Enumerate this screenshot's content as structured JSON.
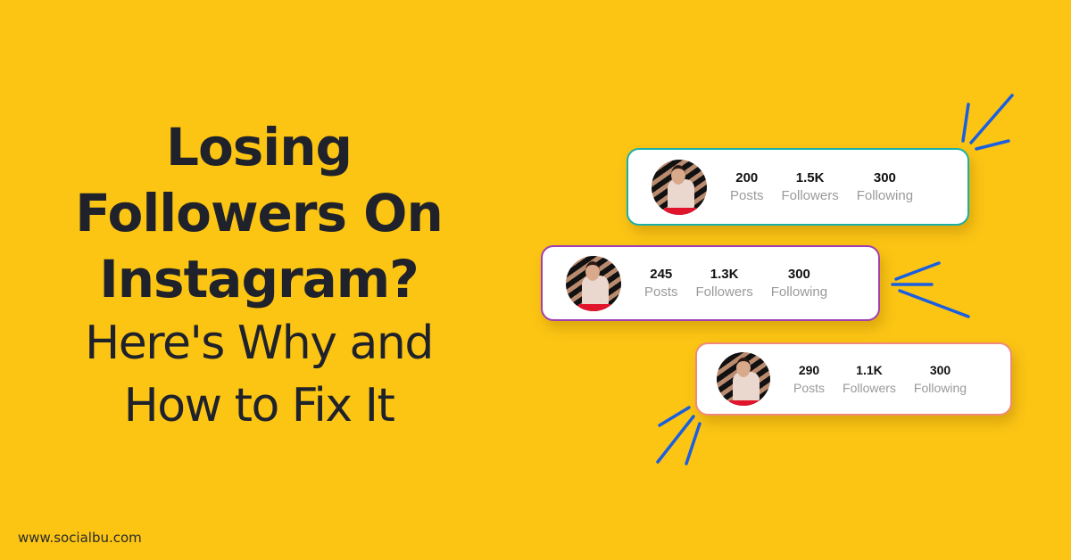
{
  "headline": {
    "line1": "Losing",
    "line2": "Followers On",
    "line3": "Instagram?",
    "line4": "Here's Why and",
    "line5": "How to Fix It"
  },
  "website": "www.socialbu.com",
  "colors": {
    "background": "#fcc514",
    "text": "#20222b",
    "ray": "#1a5fe0",
    "card1_border": "#1ab0a8",
    "card2_border": "#a040b0",
    "card3_border": "#f08a78"
  },
  "profile_cards": [
    {
      "stats": [
        {
          "value": "200",
          "label": "Posts"
        },
        {
          "value": "1.5K",
          "label": "Followers"
        },
        {
          "value": "300",
          "label": "Following"
        }
      ]
    },
    {
      "stats": [
        {
          "value": "245",
          "label": "Posts"
        },
        {
          "value": "1.3K",
          "label": "Followers"
        },
        {
          "value": "300",
          "label": "Following"
        }
      ]
    },
    {
      "stats": [
        {
          "value": "290",
          "label": "Posts"
        },
        {
          "value": "1.1K",
          "label": "Followers"
        },
        {
          "value": "300",
          "label": "Following"
        }
      ]
    }
  ]
}
